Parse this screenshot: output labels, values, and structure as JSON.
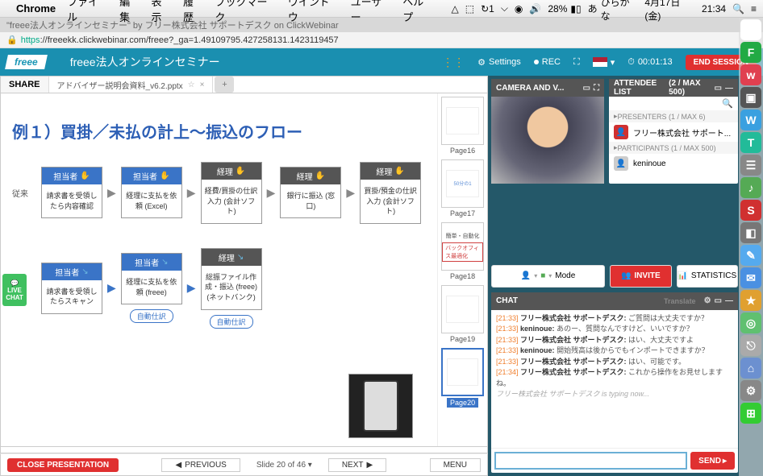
{
  "menubar": {
    "apple": "",
    "app": "Chrome",
    "items": [
      "ファイル",
      "編集",
      "表示",
      "履歴",
      "ブックマーク",
      "ウインドウ",
      "ユーザー",
      "ヘルプ"
    ],
    "battery": "28%",
    "ime_label": "ひらがな",
    "date": "4月17日(金)",
    "time": "21:34"
  },
  "browser": {
    "tab_title": "\"freee法人オンラインセミナー\" by フリー株式会社 サポートデスク on ClickWebinar",
    "url_proto": "https",
    "url_rest": "://freeekk.clickwebinar.com/freee?_ga=1.49109795.427258131.1423119457"
  },
  "header": {
    "logo": "freee",
    "title": "freee法人オンラインセミナー",
    "settings": "Settings",
    "rec": "REC",
    "timer": "00:01:13",
    "end": "END SESSION"
  },
  "share": {
    "label": "SHARE",
    "filename": "アドバイザー説明会資料_v6.2.pptx"
  },
  "slide": {
    "title": "例１）買掛／未払の計上〜振込のフロー",
    "row1_label": "従来",
    "row1": [
      {
        "head": "担当者",
        "body": "請求書を受領したら内容確認"
      },
      {
        "head": "担当者",
        "body": "経理に支払を依頼 (Excel)"
      },
      {
        "head": "経理",
        "body": "経費/買掛の仕訳入力 (会計ソフト)"
      },
      {
        "head": "経理",
        "body": "銀行に振込 (窓口)"
      },
      {
        "head": "経理",
        "body": "買掛/預金の仕訳入力 (会計ソフト)"
      }
    ],
    "row2": [
      {
        "head": "担当者",
        "body": "請求書を受領したらスキャン"
      },
      {
        "head": "担当者",
        "body": "経理に支払を依頼 (freee)"
      },
      {
        "head": "経理",
        "body": "総振ファイル作成・振込 (freee) (ネットバンク)"
      }
    ],
    "auto_tag": "自動仕訳"
  },
  "thumbs": [
    {
      "label": "Page16",
      "text": ""
    },
    {
      "label": "Page17",
      "text": "50分の1"
    },
    {
      "label": "Page18",
      "text": "バックオフィス最適化",
      "sub": "簡単・自動化"
    },
    {
      "label": "Page19",
      "text": ""
    },
    {
      "label": "Page20",
      "text": "",
      "active": true
    }
  ],
  "footer": {
    "close": "CLOSE PRESENTATION",
    "prev": "PREVIOUS",
    "counter": "Slide 20 of 46",
    "next": "NEXT",
    "menu": "MENU"
  },
  "camera": {
    "title": "CAMERA AND V..."
  },
  "attendees": {
    "title": "ATTENDEE LIST",
    "count": "(2 / MAX 500)",
    "presenters_label": "PRESENTERS (1 / MAX 6)",
    "presenter": "フリー株式会社 サポート...",
    "participants_label": "PARTICIPANTS (1 / MAX 500)",
    "participant": "keninoue"
  },
  "controls": {
    "mode": "Mode",
    "invite": "INVITE",
    "stats": "STATISTICS"
  },
  "chat": {
    "title": "CHAT",
    "translate": "Translate",
    "lines": [
      {
        "ts": "[21:33]",
        "nm": "フリー株式会社 サポートデスク:",
        "msg": " ご質問は大丈夫ですか？"
      },
      {
        "ts": "[21:33]",
        "nm": "keninoue:",
        "msg": " あのー、質問なんですけど、いいですか？"
      },
      {
        "ts": "[21:33]",
        "nm": "フリー株式会社 サポートデスク:",
        "msg": " はい、大丈夫ですよ"
      },
      {
        "ts": "[21:33]",
        "nm": "keninoue:",
        "msg": " 開始残高は後からでもインポートできますか？"
      },
      {
        "ts": "[21:33]",
        "nm": "フリー株式会社 サポートデスク:",
        "msg": " はい、可能です。"
      },
      {
        "ts": "[21:34]",
        "nm": "フリー株式会社 サポートデスク:",
        "msg": " これから操作をお見せしますね。"
      }
    ],
    "typing": "フリー株式会社 サポートデスク is typing now...",
    "send": "SEND"
  },
  "livechat": {
    "l1": "LIVE",
    "l2": "CHAT"
  },
  "dock_apps": [
    {
      "glyph": "✿",
      "bg": "#fff"
    },
    {
      "glyph": "F",
      "bg": "#2a4"
    },
    {
      "glyph": "w",
      "bg": "#e04050"
    },
    {
      "glyph": "▣",
      "bg": "#555"
    },
    {
      "glyph": "W",
      "bg": "#3aa0e0"
    },
    {
      "glyph": "T",
      "bg": "#2b9"
    },
    {
      "glyph": "☰",
      "bg": "#888"
    },
    {
      "glyph": "♪",
      "bg": "#5a5"
    },
    {
      "glyph": "S",
      "bg": "#d03030"
    },
    {
      "glyph": "◧",
      "bg": "#777"
    },
    {
      "glyph": "✎",
      "bg": "#5ae"
    },
    {
      "glyph": "✉",
      "bg": "#4a90e2"
    },
    {
      "glyph": "★",
      "bg": "#e0a030"
    },
    {
      "glyph": "◎",
      "bg": "#60c070"
    },
    {
      "glyph": "⎋",
      "bg": "#aaa"
    },
    {
      "glyph": "⌂",
      "bg": "#6c90d0"
    },
    {
      "glyph": "⚙",
      "bg": "#888"
    },
    {
      "glyph": "⊞",
      "bg": "#3c3"
    }
  ]
}
